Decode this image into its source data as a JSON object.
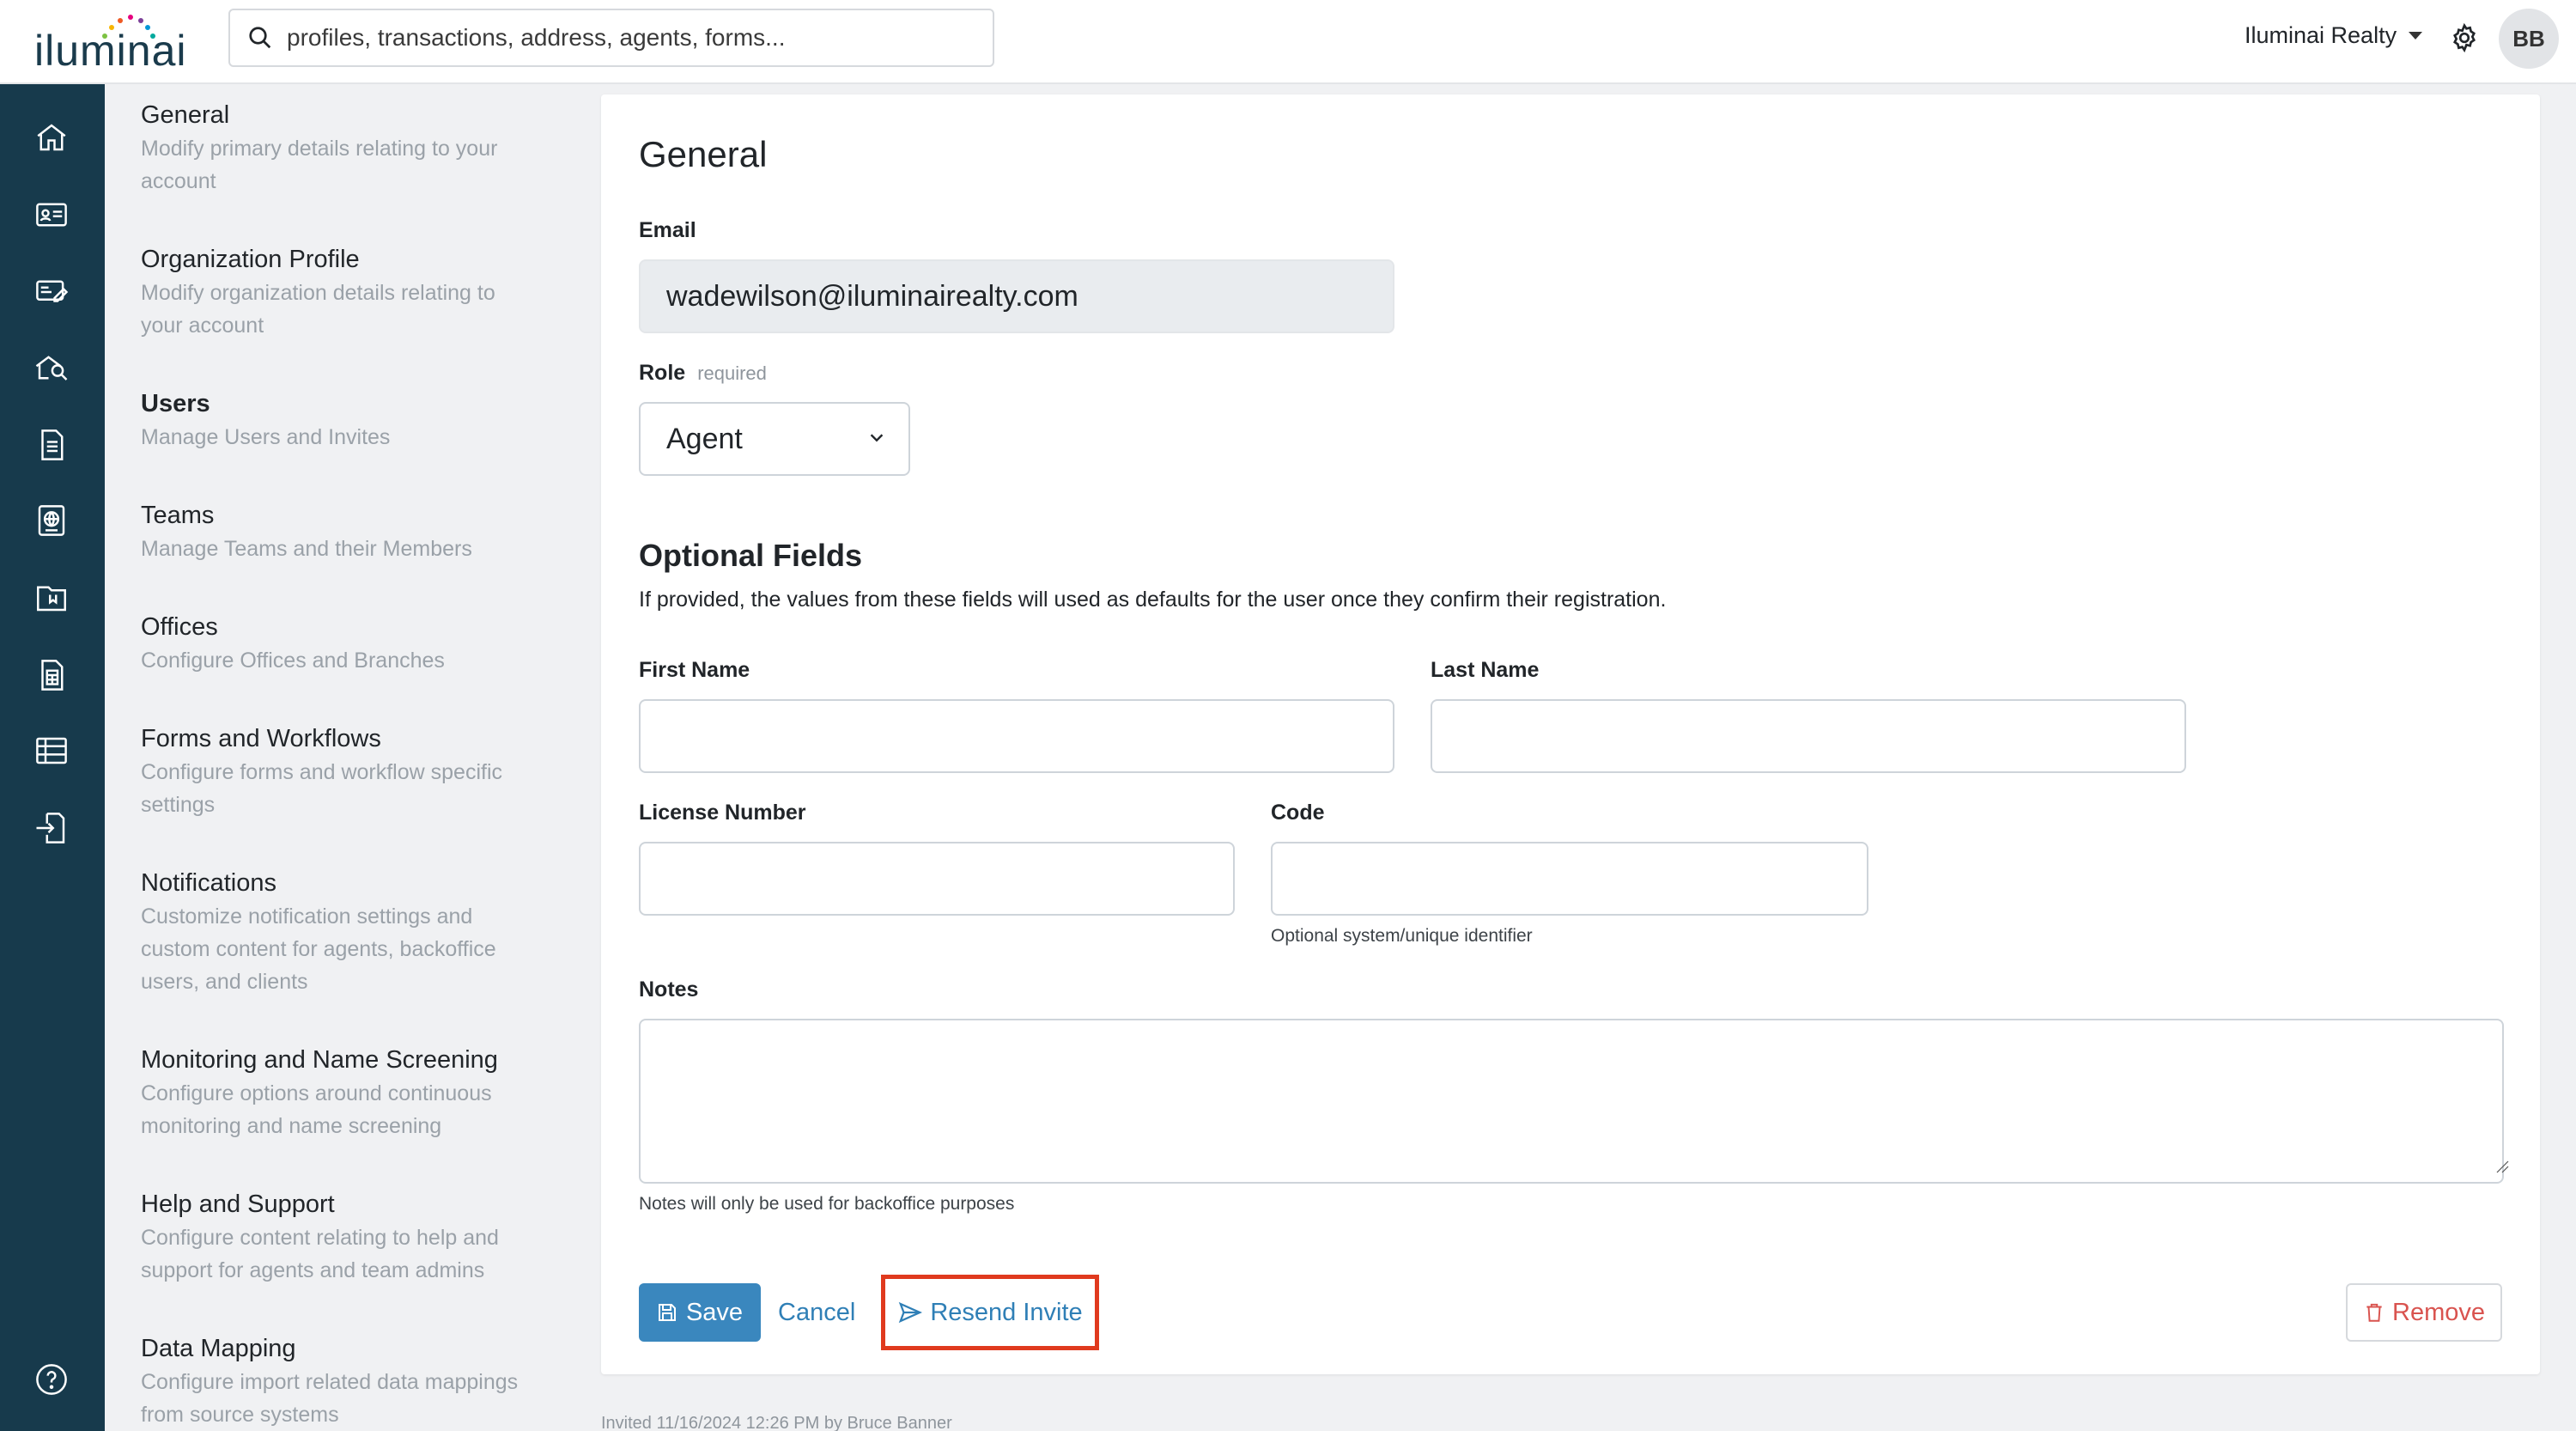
{
  "header": {
    "logo_text": "iluminai",
    "search_placeholder": "profiles, transactions, address, agents, forms...",
    "org_name": "Iluminai Realty",
    "avatar_initials": "BB"
  },
  "rail": {
    "icons": [
      "home-icon",
      "contact-card-icon",
      "transactions-icon",
      "property-search-icon",
      "document-icon",
      "globe-document-icon",
      "folder-icon",
      "calculator-document-icon",
      "table-icon",
      "import-icon",
      "help-icon"
    ]
  },
  "settings_nav": [
    {
      "title": "General",
      "desc_1": "Modify primary details relating to your",
      "desc_2": "account"
    },
    {
      "title": "Organization Profile",
      "desc_1": "Modify organization details relating to",
      "desc_2": "your account"
    },
    {
      "title": "Users",
      "desc_1": "Manage Users and Invites"
    },
    {
      "title": "Teams",
      "desc_1": "Manage Teams and their Members"
    },
    {
      "title": "Offices",
      "desc_1": "Configure Offices and Branches"
    },
    {
      "title": "Forms and Workflows",
      "desc_1": "Configure forms and workflow specific",
      "desc_2": "settings"
    },
    {
      "title": "Notifications",
      "desc_1": "Customize notification settings and",
      "desc_2": "custom content for agents, backoffice",
      "desc_3": "users, and clients"
    },
    {
      "title": "Monitoring and Name Screening",
      "desc_1": "Configure options around continuous",
      "desc_2": "monitoring and name screening"
    },
    {
      "title": "Help and Support",
      "desc_1": "Configure content relating to help and",
      "desc_2": "support for agents and team admins"
    },
    {
      "title": "Data Mapping",
      "desc_1": "Configure import related data mappings",
      "desc_2": "from source systems"
    }
  ],
  "form": {
    "heading": "General",
    "email_label": "Email",
    "email_value": "wadewilson@iluminairealty.com",
    "role_label": "Role",
    "role_required": "required",
    "role_value": "Agent",
    "optional_heading": "Optional Fields",
    "optional_desc": "If provided, the values from these fields will used as defaults for the user once they confirm their registration.",
    "first_name_label": "First Name",
    "first_name_value": "",
    "last_name_label": "Last Name",
    "last_name_value": "",
    "license_label": "License Number",
    "license_value": "",
    "code_label": "Code",
    "code_value": "",
    "code_hint": "Optional system/unique identifier",
    "notes_label": "Notes",
    "notes_value": "",
    "notes_hint": "Notes will only be used for backoffice purposes"
  },
  "actions": {
    "save": "Save",
    "cancel": "Cancel",
    "resend": "Resend Invite",
    "remove": "Remove"
  },
  "footer": {
    "invited_note": "Invited 11/16/2024 12:26 PM by Bruce Banner"
  },
  "colors": {
    "rail_bg": "#173a4c",
    "primary": "#3a87be",
    "link": "#2f7fb6",
    "danger": "#d9534f",
    "highlight": "#e03a1e"
  }
}
